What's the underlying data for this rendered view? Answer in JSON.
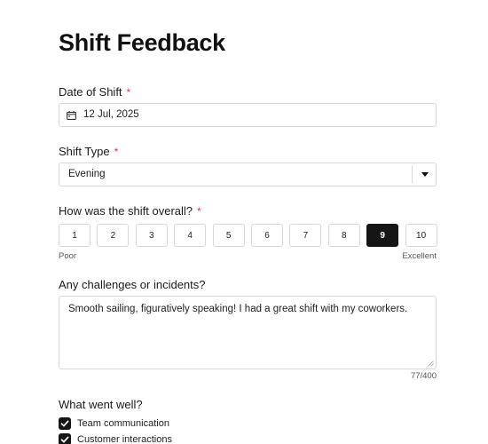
{
  "page": {
    "title": "Shift Feedback"
  },
  "date_field": {
    "label": "Date of Shift",
    "required_mark": "*",
    "value": "12 Jul, 2025",
    "icon": "calendar-icon"
  },
  "shift_type": {
    "label": "Shift Type",
    "required_mark": "*",
    "value": "Evening",
    "icon": "chevron-down-icon"
  },
  "overall": {
    "label": "How was the shift overall?",
    "required_mark": "*",
    "options": [
      "1",
      "2",
      "3",
      "4",
      "5",
      "6",
      "7",
      "8",
      "9",
      "10"
    ],
    "selected": "9",
    "low_label": "Poor",
    "high_label": "Excellent"
  },
  "challenges": {
    "label": "Any challenges or incidents?",
    "value": "Smooth sailing, figuratively speaking! I had a great shift with my coworkers.",
    "counter": "77/400"
  },
  "went_well": {
    "label": "What went well?",
    "options": [
      {
        "label": "Team communication",
        "checked": true
      },
      {
        "label": "Customer interactions",
        "checked": true
      }
    ]
  },
  "colors": {
    "accent": "#151515",
    "required": "#e0306c",
    "border": "#d8d8d8"
  }
}
